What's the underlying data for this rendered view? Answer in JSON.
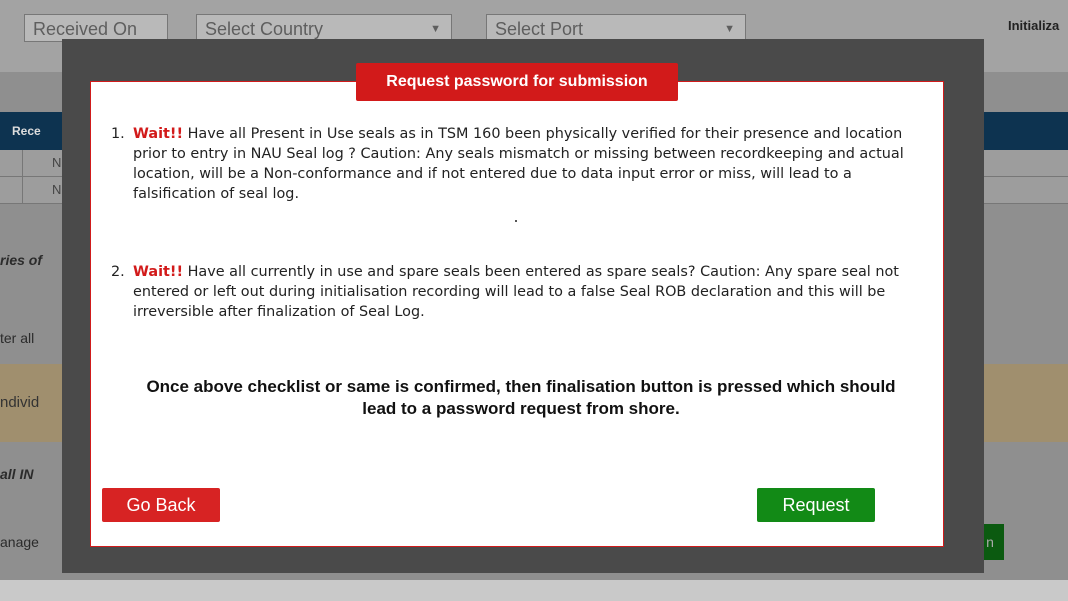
{
  "background": {
    "filters": {
      "received_on": "Received On",
      "select_country": "Select Country",
      "select_port": "Select Port",
      "dropdown_arrow": "▼"
    },
    "header_right_text": "Initializa",
    "table_header_partial": "Rece",
    "row_values": [
      "N",
      "N"
    ],
    "partial_texts": {
      "entries": "ries of",
      "enter_all": "ter all",
      "individual": "ndivid",
      "all_in": "all IN",
      "manage": "anage"
    },
    "green_button_partial": "n"
  },
  "modal": {
    "title": "Request password for submission",
    "items": [
      {
        "number": "1.",
        "wait": "Wait!!",
        "text": " Have all Present in Use seals as in TSM 160 been physically verified for their presence and location prior to entry in NAU Seal log ? Caution: Any seals mismatch or missing between recordkeeping and actual location, will be a Non-conformance and if not entered due to data input error or miss, will lead to a falsification of seal log."
      },
      {
        "number": "2.",
        "wait": "Wait!!",
        "text": " Have all currently in use and spare seals been entered as spare seals? Caution: Any spare seal not entered or left out during initialisation recording will lead to a false Seal ROB declaration and this will be irreversible after finalization of Seal Log."
      }
    ],
    "confirmation": "Once above checklist or same is confirmed, then finalisation button is pressed which should lead to a password request from shore.",
    "buttons": {
      "back": "Go Back",
      "request": "Request"
    }
  },
  "colors": {
    "accent_red": "#d21a1a",
    "request_green": "#128a16",
    "table_header_navy": "#0d3350"
  }
}
